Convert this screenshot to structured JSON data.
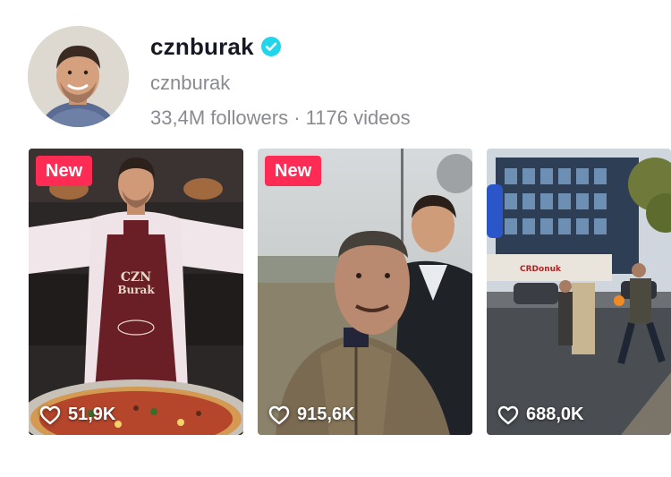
{
  "profile": {
    "username": "cznburak",
    "handle": "cznburak",
    "followers": "33,4M followers",
    "separator": "·",
    "videos": "1176 videos",
    "verified": true,
    "verified_color": "#20d5ec"
  },
  "badge_color": "#fe2c55",
  "videos": [
    {
      "badge": "New",
      "likes": "51,9K",
      "apron_text": "CZN Burak"
    },
    {
      "badge": "New",
      "likes": "915,6K"
    },
    {
      "badge": "",
      "likes": "688,0K",
      "sign_text": "CRDonuk"
    }
  ]
}
